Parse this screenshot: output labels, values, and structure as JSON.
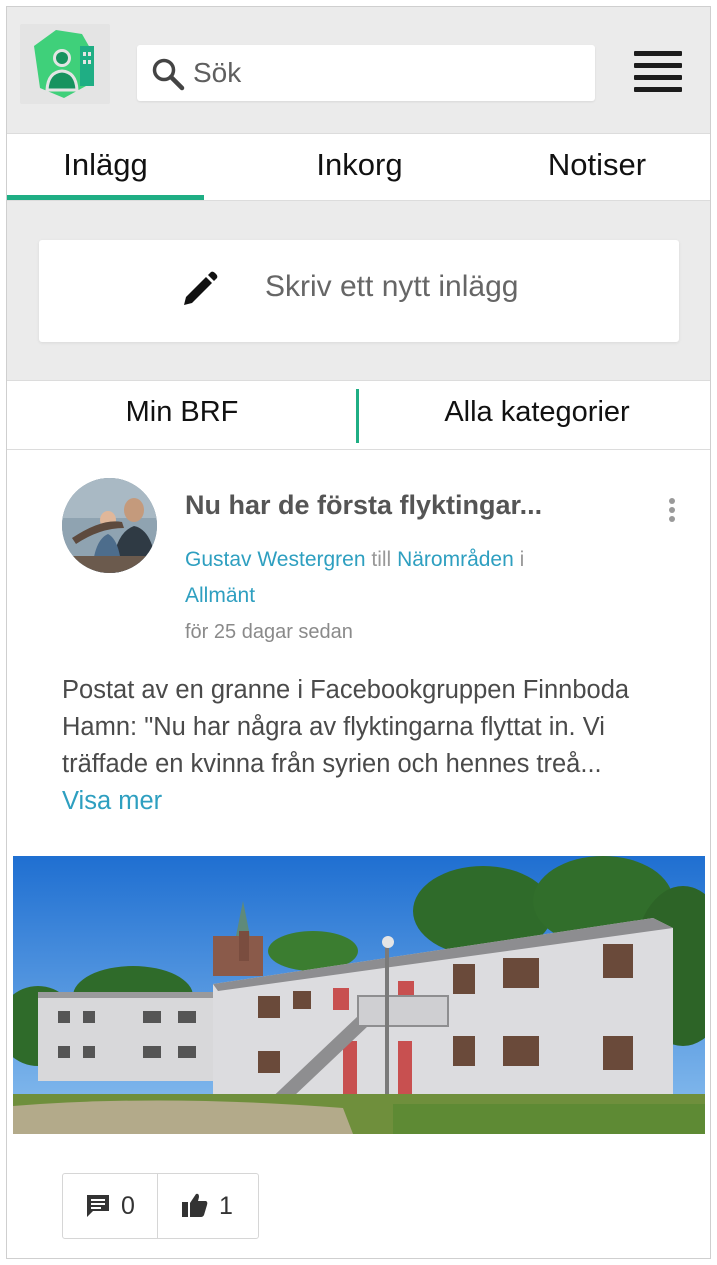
{
  "search": {
    "placeholder": "Sök"
  },
  "tabs": [
    {
      "label": "Inlägg",
      "active": true
    },
    {
      "label": "Inkorg"
    },
    {
      "label": "Notiser"
    }
  ],
  "compose": {
    "label": "Skriv ett nytt inlägg"
  },
  "filter": {
    "left": "Min BRF",
    "right": "Alla kategorier"
  },
  "post": {
    "title": "Nu har de första flyktingar...",
    "author": "Gustav Westergren",
    "to_word": "till",
    "area": "Närområden",
    "in_word": "i",
    "category": "Allmänt",
    "time": "för 25 dagar sedan",
    "body": "Postat av en granne i Facebookgruppen Finnboda Hamn: \"Nu har några av flyktingarna flyttat in. Vi träffade en kvinna från syrien och hennes treå...",
    "more": "Visa mer",
    "comments": "0",
    "likes": "1"
  },
  "colors": {
    "accent": "#1fae84",
    "link": "#2e9fc0",
    "logo_green": "#2ecc71"
  },
  "icons": [
    "app-logo-icon",
    "search-icon",
    "menu-icon",
    "pencil-icon",
    "more-vertical-icon",
    "comment-icon",
    "thumbs-up-icon"
  ]
}
